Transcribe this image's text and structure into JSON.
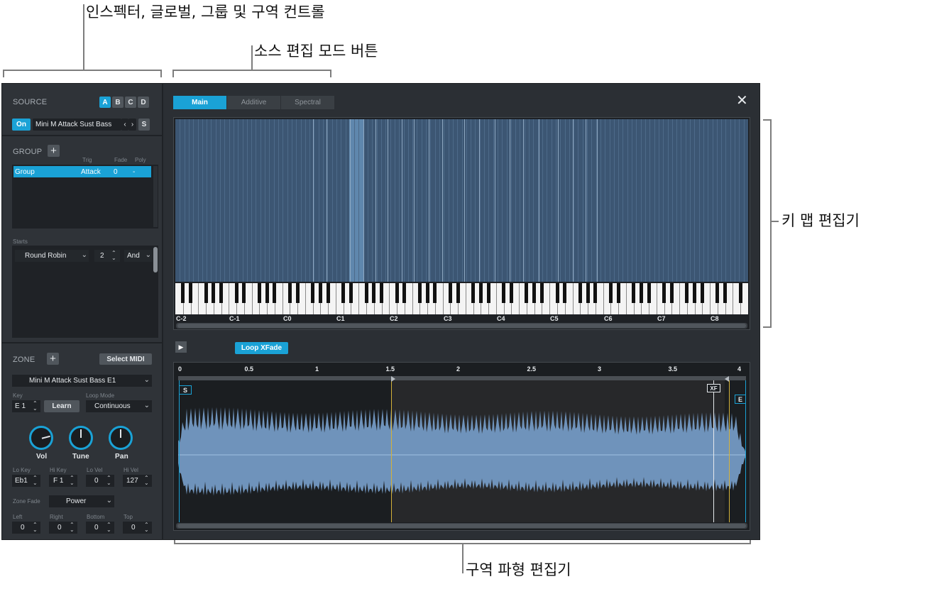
{
  "callouts": {
    "inspector": "인스펙터, 글로벌, 그룹 및 구역 컨트롤",
    "source_mode": "소스 편집 모드 버튼",
    "key_map": "키 맵 편집기",
    "zone_wave": "구역 파형 편집기"
  },
  "source": {
    "title": "SOURCE",
    "slots": [
      "A",
      "B",
      "C",
      "D"
    ],
    "on_label": "On",
    "sample_name": "Mini M Attack Sust Bass",
    "prev": "‹",
    "next": "›",
    "s_label": "S"
  },
  "group": {
    "title": "GROUP",
    "add": "+",
    "col_trig": "Trig",
    "col_fade": "Fade",
    "col_poly": "Poly",
    "row": {
      "name": "Group",
      "trig": "Attack",
      "fade": "0",
      "poly": "-"
    },
    "starts_label": "Starts",
    "starts_mode": "Round Robin",
    "starts_count": "2",
    "starts_logic": "And"
  },
  "zone": {
    "title": "ZONE",
    "add": "+",
    "select_midi": "Select MIDI",
    "sample_name": "Mini M Attack Sust Bass E1",
    "key_label": "Key",
    "key_value": "E 1",
    "learn": "Learn",
    "loop_mode_label": "Loop Mode",
    "loop_mode": "Continuous",
    "knobs": [
      {
        "label": "Vol",
        "level": 0.78
      },
      {
        "label": "Tune",
        "level": 0.5
      },
      {
        "label": "Pan",
        "level": 0.5
      }
    ],
    "lo_key_label": "Lo Key",
    "lo_key": "Eb1",
    "hi_key_label": "Hi Key",
    "hi_key": "F 1",
    "lo_vel_label": "Lo Vel",
    "lo_vel": "0",
    "hi_vel_label": "Hi Vel",
    "hi_vel": "127",
    "zone_fade_label": "Zone Fade",
    "zone_fade": "Power",
    "left_label": "Left",
    "left": "0",
    "right_label": "Right",
    "right": "0",
    "bottom_label": "Bottom",
    "bottom": "0",
    "top_label": "Top",
    "top": "0"
  },
  "tabs": [
    "Main",
    "Additive",
    "Spectral"
  ],
  "close": "✕",
  "keymap": {
    "octaves": [
      "C-2",
      "C-1",
      "C0",
      "C1",
      "C2",
      "C3",
      "C4",
      "C5",
      "C6",
      "C7",
      "C8"
    ]
  },
  "wave": {
    "play": "▶",
    "loop_xfade": "Loop XFade",
    "ruler": [
      "0",
      "0.5",
      "1",
      "1.5",
      "2",
      "2.5",
      "3",
      "3.5",
      "4"
    ],
    "start_marker": "S",
    "end_marker": "E",
    "xf_marker": "XF"
  },
  "colors": {
    "accent": "#1aa2d6",
    "panel": "#2f3338",
    "waveform": "#6f93bb",
    "loop_marker": "#d4b23a"
  }
}
